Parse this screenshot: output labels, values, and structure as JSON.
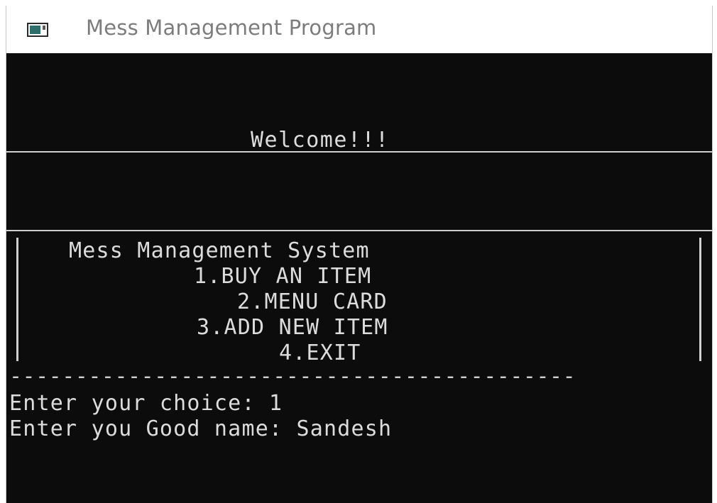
{
  "window": {
    "title": "Mess Management Program"
  },
  "console": {
    "welcome": "Welcome!!!",
    "menu": {
      "heading": "Mess Management System",
      "items": [
        "1.BUY AN ITEM",
        "2.MENU CARD",
        "3.ADD NEW ITEM",
        "4.EXIT"
      ]
    },
    "separator": "-------------------------------------------",
    "prompts": [
      "Enter your choice: 1",
      "Enter you  Good name: Sandesh"
    ]
  },
  "colors": {
    "console_background": "#0c0c0c",
    "console_text": "#dcdcdc",
    "titlebar_background": "#ffffff",
    "title_text": "#7c7c7c"
  },
  "icons": {
    "app": "console-window-icon"
  }
}
